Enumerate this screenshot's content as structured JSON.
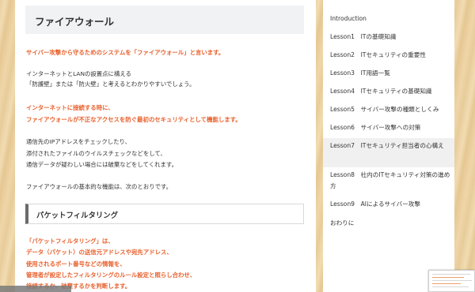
{
  "article": {
    "title": "ファイアウォール",
    "p1": "サイバー攻撃から守るためのシステムを「ファイアウォール」と言います。",
    "p2a": "インターネットとLANの設置点に構える",
    "p2b": "「防護壁」または「防火壁」と考えるとわかりやすいでしょう。",
    "p3a": "インターネットに接続する時に、",
    "p3b": "ファイアウォールが不正なアクセスを防ぐ最初のセキュリティとして機能します。",
    "p4a": "通信先のIPアドレスをチェックしたり、",
    "p4b": "添付されたファイルのウイルスチェックなどをして、",
    "p4c": "通信データが疑わしい場合には破棄などをしてくれます。",
    "p5": "ファイアウォールの基本的な機能は、次のとおりです。",
    "section_heading": "パケットフィルタリング",
    "p6a": "「パケットフィルタリング」は、",
    "p6b": "データ（パケット）の送信元アドレスや宛先アドレス、",
    "p6c": "使用されるポート番号などの情報を、",
    "p6d": "管理者が設定したフィルタリングのルール設定と照らし合わせ、",
    "p6e": "接続するか、破棄するかを判断します。"
  },
  "sidebar": {
    "items": [
      {
        "label": "Introduction"
      },
      {
        "label": "Lesson1　ITの基礎知識"
      },
      {
        "label": "Lesson2　ITセキュリティの重要性"
      },
      {
        "label": "Lesson3　IT用語一覧"
      },
      {
        "label": "Lesson4　ITセキュリティの基礎知識"
      },
      {
        "label": "Lesson5　サイバー攻撃の種類としくみ"
      },
      {
        "label": "Lesson6　サイバー攻撃への対策"
      },
      {
        "label": "Lesson7　ITセキュリティ担当者の心構え",
        "active": true
      },
      {
        "label": "Lesson8　社内のITセキュリティ対策の進め方"
      },
      {
        "label": "Lesson9　AIによるサイバー攻撃"
      },
      {
        "label": "おわりに"
      }
    ]
  },
  "colors": {
    "accent_orange": "#e8602c",
    "heading_bg": "#f1f2f3",
    "active_item_bg": "#f0f0f0"
  }
}
